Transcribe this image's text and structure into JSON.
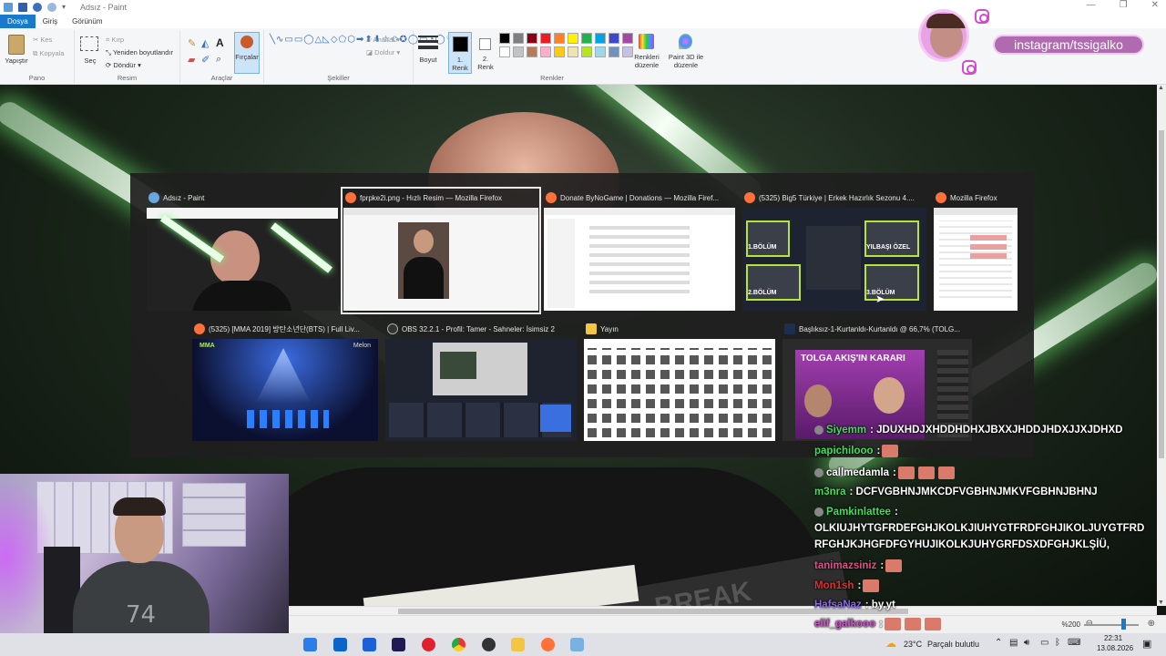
{
  "paint": {
    "title": "Adsız - Paint",
    "tabs": [
      "Dosya",
      "Giriş",
      "Görünüm"
    ],
    "ribbon": {
      "paste": "Yapıştır",
      "cut": "Kes",
      "copy": "Kopyala",
      "select": "Seç",
      "crop": "Kırp",
      "resize": "Yeniden boyutlandır",
      "rotate": "Döndür",
      "brushes": "Fırçalar",
      "outline": "Anahat",
      "fill": "Doldur",
      "size": "Boyut",
      "color1": "1.",
      "color1b": "Renk",
      "color2": "2.",
      "color2b": "Renk",
      "edit_colors_1": "Renkleri",
      "edit_colors_2": "düzenle",
      "paint3d_1": "Paint 3D ile",
      "paint3d_2": "düzenle",
      "groups": {
        "clipboard": "Pano",
        "image": "Resim",
        "tools": "Araçlar",
        "shapes": "Şekiller",
        "colors": "Renkler"
      }
    },
    "palette": [
      "#000000",
      "#7f7f7f",
      "#880015",
      "#ed1c24",
      "#ff7f27",
      "#fff200",
      "#22b14c",
      "#00a2e8",
      "#3f48cc",
      "#a349a4",
      "#ffffff",
      "#c3c3c3",
      "#b97a57",
      "#ffaec9",
      "#ffc90e",
      "#efe4b0",
      "#b5e61d",
      "#99d9ea",
      "#7092be",
      "#c8bfe7"
    ],
    "zoom": "%200"
  },
  "switcher": {
    "windows": [
      {
        "title": "Adsız - Paint",
        "icon": "paint-icon"
      },
      {
        "title": "fprpke2i.png - Hızlı Resim — Mozilla Firefox",
        "icon": "firefox-icon"
      },
      {
        "title": "Donate ByNoGame | Donations — Mozilla Firef...",
        "icon": "firefox-icon"
      },
      {
        "title": "(5325) Big5 Türkiye | Erkek Hazırlık Sezonu 4....",
        "icon": "firefox-icon"
      },
      {
        "title": "Mozilla Firefox",
        "icon": "firefox-icon"
      },
      {
        "title": "(5325) [MMA 2019] 방탄소년단(BTS) | Full Liv...",
        "icon": "firefox-icon"
      },
      {
        "title": "OBS 32.2.1 - Profil: Tamer - Sahneler: İsimsiz 2",
        "icon": "obs-icon"
      },
      {
        "title": "Yayın",
        "icon": "folder-icon"
      },
      {
        "title": "Başlıksız-1-Kurtanldı-Kurtanldı @ 66,7% (TOLG...",
        "icon": "photoshop-icon"
      }
    ],
    "thumb_texts": {
      "mma": "MMA",
      "melon": "Melon",
      "tolga": "TOLGA AKIŞ'IN KARARI",
      "bolum1": "1.BÖLÜM",
      "bolum2": "2.BÖLÜM",
      "bolum3": "3.BÖLÜM",
      "yilbasi": "YILBAŞI ÖZEL"
    }
  },
  "overlay": {
    "instagram": "instagram/tssigalko"
  },
  "canvas": {
    "book_text": "BREAK"
  },
  "webcam": {
    "shirt_number": "74"
  },
  "chat": [
    {
      "user": "Siyemm",
      "color": "#3ee05a",
      "text": ": JDUXHDJXHDDHDHXJBXXJHDDJHDXJJXJDHXD"
    },
    {
      "user": "papichilooo",
      "color": "#3ee05a",
      "text": ":"
    },
    {
      "user": "callmedamla",
      "color": "#ffffff",
      "text": ":"
    },
    {
      "user": "m3nra",
      "color": "#3ee05a",
      "text": ": DCFVGBHNJMKCDFVGBHNJMKVFGBHNJBHNJ"
    },
    {
      "user": "Pamkinlattee",
      "color": "#3ee05a",
      "text": ":"
    },
    {
      "user": "",
      "color": "#ffffff",
      "text": "OLKIUJHYTGFRDEFGHJKOLKJIUHYGTFRDFGHJIKOLJUYGTFRD"
    },
    {
      "user": "",
      "color": "#ffffff",
      "text": "RFGHJKJHGFDFGYHUJIKOLKJUHYGRFDSXDFGHJKLŞİÜ,"
    },
    {
      "user": "tanimazsiniz",
      "color": "#e0508a",
      "text": ":"
    },
    {
      "user": "Mon1sh",
      "color": "#e03030",
      "text": ":"
    },
    {
      "user": "HafsaNaz",
      "color": "#8a6ae0",
      "text": ": by.yt"
    },
    {
      "user": "elif_galkooo",
      "color": "#d050d0",
      "text": ":"
    }
  ],
  "taskbar": {
    "weather": "23°C",
    "weather_text": "Parçalı bulutlu",
    "time": "22:31",
    "date": "13.08.2026"
  }
}
